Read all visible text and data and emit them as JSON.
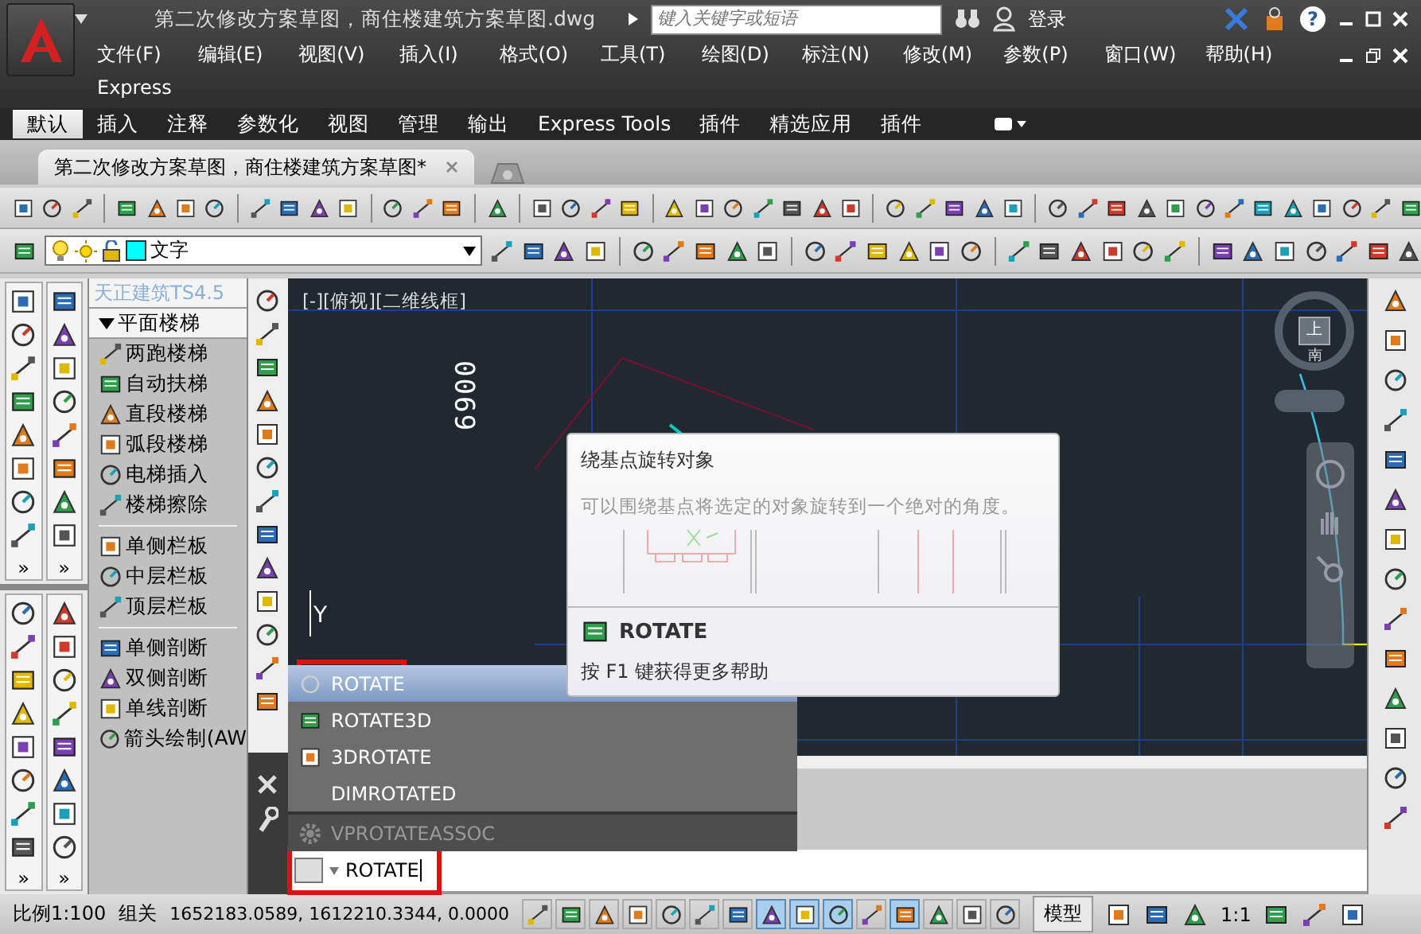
{
  "title_bar": {
    "document_title": "第二次修改方案草图，商住楼建筑方案草图.dwg",
    "search_placeholder": "键入关键字或短语",
    "login": "登录",
    "help": "?"
  },
  "menu": [
    "文件(F)",
    "编辑(E)",
    "视图(V)",
    "插入(I)",
    "格式(O)",
    "工具(T)",
    "绘图(D)",
    "标注(N)",
    "修改(M)",
    "参数(P)",
    "窗口(W)",
    "帮助(H)",
    "Express"
  ],
  "ribbon_tabs": [
    {
      "label": "默认",
      "selected": true
    },
    {
      "label": "插入",
      "selected": false
    },
    {
      "label": "注释",
      "selected": false
    },
    {
      "label": "参数化",
      "selected": false
    },
    {
      "label": "视图",
      "selected": false
    },
    {
      "label": "管理",
      "selected": false
    },
    {
      "label": "输出",
      "selected": false
    },
    {
      "label": "Express Tools",
      "selected": false
    },
    {
      "label": "插件",
      "selected": false
    },
    {
      "label": "精选应用",
      "selected": false
    },
    {
      "label": "插件",
      "selected": false
    }
  ],
  "document_tabs": [
    {
      "label": "第二次修改方案草图，商住楼建筑方案草图*",
      "selected": true
    }
  ],
  "layer_combo": {
    "value": "文字"
  },
  "left_toolbars": [
    {
      "more": "»"
    },
    {
      "more": "»"
    },
    {
      "more": "»"
    },
    {
      "more": "»"
    }
  ],
  "tianzheng_panel": {
    "title": "天正建筑TS4.5",
    "section": {
      "label": "平面楼梯",
      "expanded": true
    },
    "groups": [
      {
        "items": [
          "两跑楼梯",
          "自动扶梯",
          "直段楼梯",
          "弧段楼梯",
          "电梯插入",
          "楼梯擦除"
        ]
      },
      {
        "items": [
          "单侧栏板",
          "中层栏板",
          "顶层栏板"
        ]
      },
      {
        "items": [
          "单侧剖断",
          "双侧剖断",
          "单线剖断",
          "箭头绘制(AW"
        ]
      }
    ]
  },
  "viewport": {
    "view_label": "[-][俯视][二维线框]",
    "dimension": "6900",
    "axis_label": "Y",
    "viewcube_top": "上",
    "viewcube_south": "南"
  },
  "tooltip": {
    "title": "绕基点旋转对象",
    "description": "可以围绕基点将选定的对象旋转到一个绝对的角度。",
    "command": "ROTATE",
    "help": "按 F1 键获得更多帮助"
  },
  "autocomplete": [
    {
      "label": "ROTATE",
      "kind": "command",
      "selected": true
    },
    {
      "label": "ROTATE3D",
      "kind": "command",
      "selected": false
    },
    {
      "label": "3DROTATE",
      "kind": "command",
      "selected": false
    },
    {
      "label": "DIMROTATED",
      "kind": "command",
      "selected": false
    },
    {
      "label": "VPROTATEASSOC",
      "kind": "variable",
      "selected": false
    }
  ],
  "command_line": {
    "value": "ROTATE"
  },
  "status_bar": {
    "scale": "比例1:100",
    "group": "组关",
    "coordinates": "1652183.0589, 1612210.3344, 0.0000",
    "model": "模型",
    "annotation_scale": "1:1",
    "toggles": [
      {
        "on": false
      },
      {
        "on": false
      },
      {
        "on": false
      },
      {
        "on": false
      },
      {
        "on": false
      },
      {
        "on": false
      },
      {
        "on": false
      },
      {
        "on": true
      },
      {
        "on": true
      },
      {
        "on": true
      },
      {
        "on": false
      },
      {
        "on": true
      },
      {
        "on": false
      },
      {
        "on": false
      },
      {
        "on": false
      }
    ]
  }
}
